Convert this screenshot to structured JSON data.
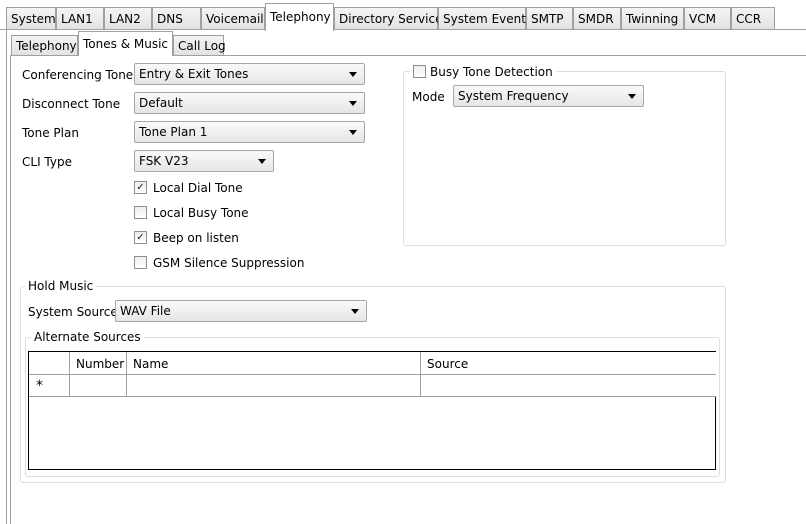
{
  "top_tabs": [
    "System",
    "LAN1",
    "LAN2",
    "DNS",
    "Voicemail",
    "Telephony",
    "Directory Services",
    "System Events",
    "SMTP",
    "SMDR",
    "Twinning",
    "VCM",
    "CCR"
  ],
  "active_top_tab": "Telephony",
  "sub_tabs": [
    "Telephony",
    "Tones & Music",
    "Call Log"
  ],
  "active_sub_tab": "Tones & Music",
  "fields": {
    "conferencing_tone": {
      "label": "Conferencing Tone",
      "value": "Entry & Exit Tones"
    },
    "disconnect_tone": {
      "label": "Disconnect Tone",
      "value": "Default"
    },
    "tone_plan": {
      "label": "Tone Plan",
      "value": "Tone Plan 1"
    },
    "cli_type": {
      "label": "CLI Type",
      "value": "FSK V23"
    }
  },
  "checkboxes": {
    "local_dial_tone": {
      "label": "Local Dial Tone",
      "checked": true
    },
    "local_busy_tone": {
      "label": "Local Busy Tone",
      "checked": false
    },
    "beep_on_listen": {
      "label": "Beep on listen",
      "checked": true
    },
    "gsm_silence": {
      "label": "GSM Silence Suppression",
      "checked": false
    }
  },
  "busy_tone": {
    "title": "Busy Tone Detection",
    "checked": false,
    "mode_label": "Mode",
    "mode_value": "System Frequency"
  },
  "hold_music": {
    "title": "Hold Music",
    "system_source_label": "System Source",
    "system_source_value": "WAV File",
    "alternate_title": "Alternate Sources",
    "columns": [
      "Number",
      "Name",
      "Source"
    ],
    "new_row_marker": "*"
  }
}
